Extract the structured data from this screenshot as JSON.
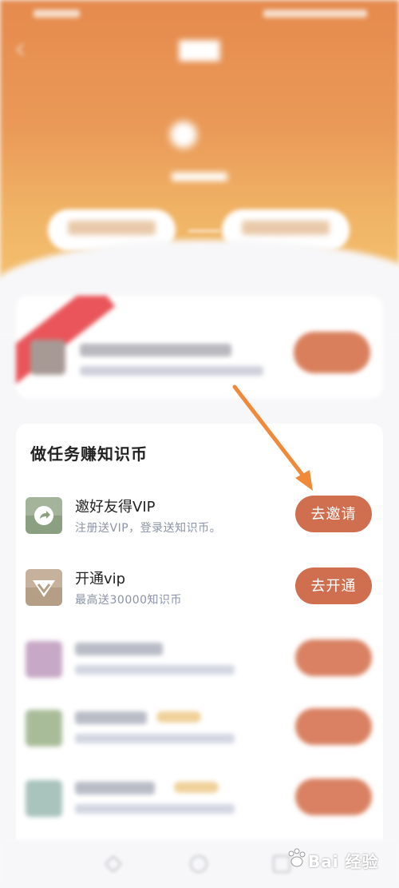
{
  "task_section": {
    "title": "做任务赚知识币",
    "tasks": [
      {
        "name": "邀好友得VIP",
        "desc": "注册送VIP，登录送知识币。",
        "button": "去邀请",
        "icon": "share-arrow-icon"
      },
      {
        "name": "开通vip",
        "desc": "最高送30000知识币",
        "button": "去开通",
        "icon": "vip-diamond-icon"
      }
    ]
  },
  "watermark": {
    "text": "Bai 经验"
  },
  "colors": {
    "header": "#e8925a",
    "task_button": "#cf6f4f",
    "annotation_arrow": "#f08a3a"
  }
}
